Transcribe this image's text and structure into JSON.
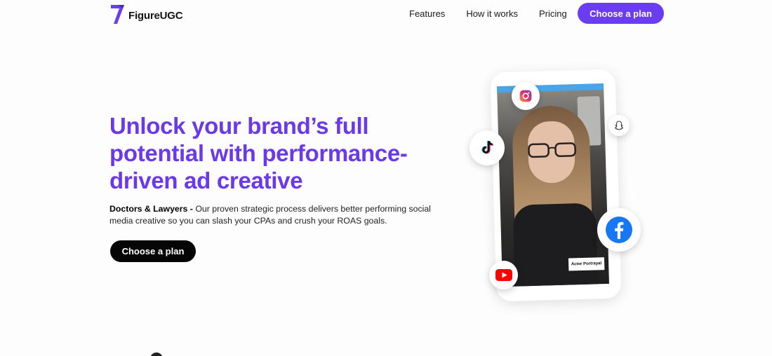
{
  "header": {
    "logo_text": "FigureUGC",
    "nav": {
      "features": "Features",
      "how_it_works": "How it works",
      "pricing": "Pricing"
    },
    "cta_label": "Choose a plan"
  },
  "hero": {
    "title_line1": "Unlock your brand’s full",
    "title_line2": "potential with performance-",
    "title_line3": "driven ad creative",
    "desc_strong": "Doctors & Lawyers -",
    "desc_text": " Our proven strategic process delivers better performing social media creative so you can slash your CPAs and crush your ROAS goals.",
    "cta_label": "Choose a plan"
  },
  "phone": {
    "actor_label": "Actor Portrayal",
    "social_icons": [
      "instagram-icon",
      "snapchat-icon",
      "tiktok-icon",
      "facebook-icon",
      "youtube-icon"
    ]
  },
  "colors": {
    "brand": "#6a3cf2",
    "title": "#6b38ec",
    "dark_button": "#050505"
  }
}
